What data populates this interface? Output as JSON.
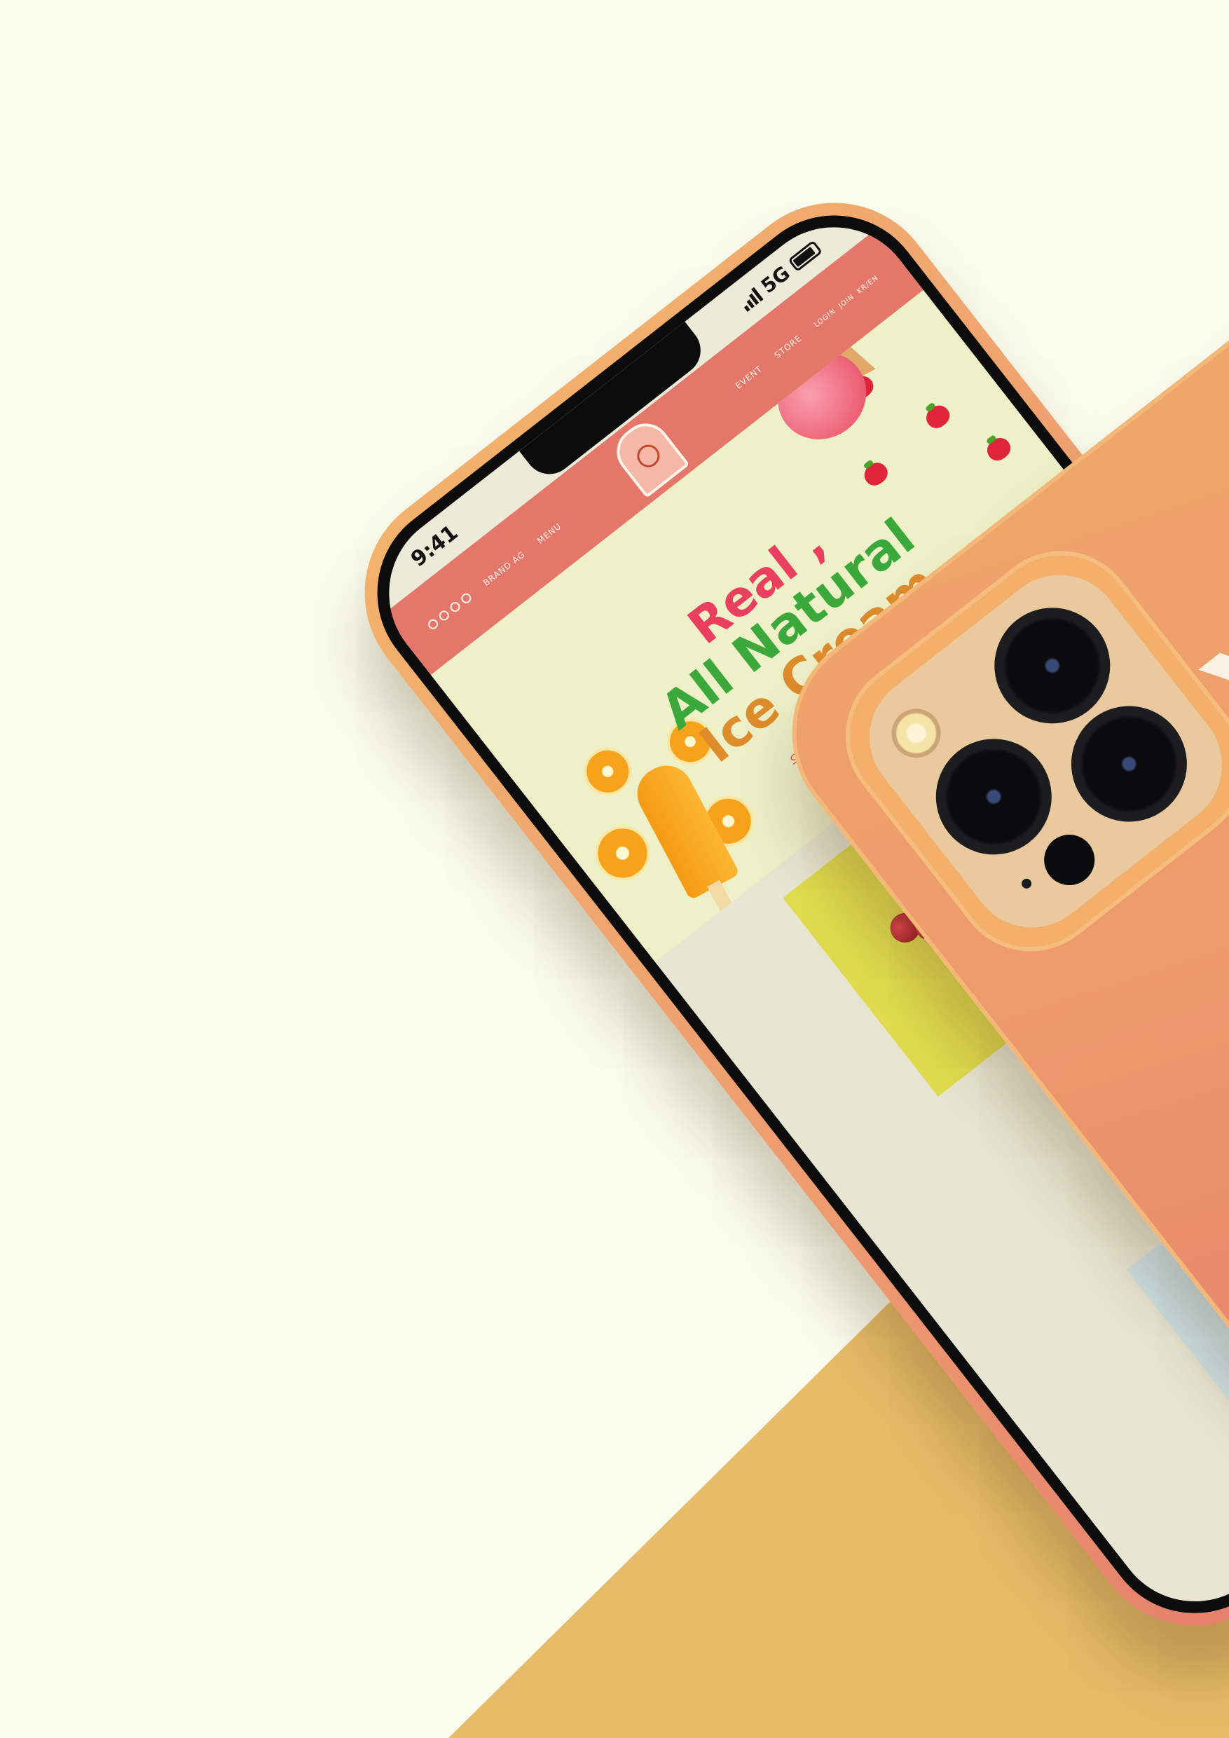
{
  "background": {
    "light": "#fafcee",
    "wedge": "#e8bb68"
  },
  "status_bar": {
    "time": "9:41",
    "network": "5G"
  },
  "site": {
    "nav_left": [
      "BRAND AG"
    ],
    "nav_center": [
      "MENU",
      "EVENT",
      "STORE"
    ],
    "nav_utils": [
      "LOGIN",
      "JOIN",
      "KR/EN"
    ],
    "hero": {
      "line1": "Real ,",
      "line2": "All Natural",
      "line3": "Ice Cream",
      "subtitle": "우리는 건강한 아이스크림"
    }
  },
  "case": {
    "brand_text": "Yum",
    "color": "#ed9a6d"
  }
}
